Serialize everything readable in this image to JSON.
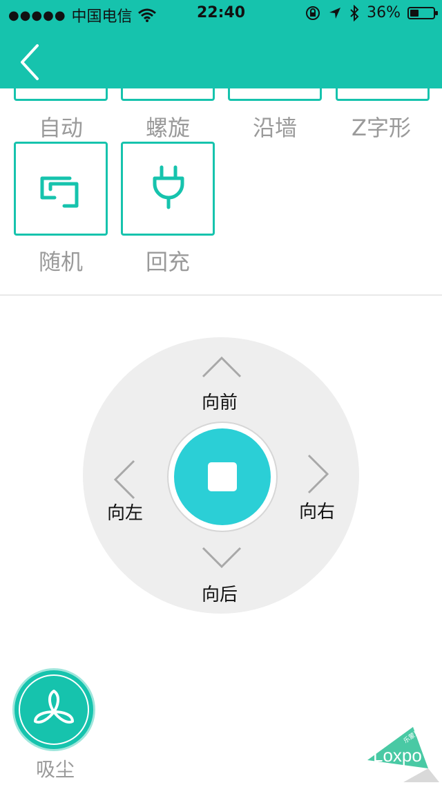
{
  "status_bar": {
    "carrier_dots": "●●●●●",
    "carrier": "中国电信",
    "time": "22:40",
    "battery_percent": "36%",
    "battery_level": 0.36
  },
  "modes": [
    {
      "label": "自动",
      "icon": "auto-mode-icon"
    },
    {
      "label": "螺旋",
      "icon": "spiral-mode-icon"
    },
    {
      "label": "沿墙",
      "icon": "wall-follow-icon"
    },
    {
      "label": "Z字形",
      "icon": "zigzag-icon"
    },
    {
      "label": "随机",
      "icon": "random-mode-icon"
    },
    {
      "label": "回充",
      "icon": "plug-icon"
    }
  ],
  "dpad": {
    "forward": "向前",
    "back": "向后",
    "left": "向左",
    "right": "向右"
  },
  "vacuum": {
    "label": "吸尘",
    "icon": "fan-icon"
  },
  "brand": {
    "logo_text": "Loxpo",
    "logo_small_text": "乐蒙尼"
  },
  "colors": {
    "accent": "#16c3ad",
    "stop": "#2bcfd6",
    "pad": "#eeeeee",
    "label_gray": "#9a9a9a"
  }
}
